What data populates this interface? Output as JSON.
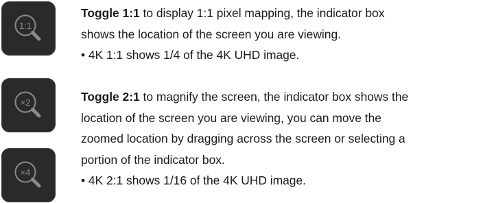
{
  "icons": {
    "zoom_1_1": {
      "label": "1:1",
      "name": "magnifier-1-1-icon"
    },
    "zoom_x2": {
      "label": "×2",
      "name": "magnifier-x2-icon"
    },
    "zoom_x4": {
      "label": "×4",
      "name": "magnifier-x4-icon"
    }
  },
  "section_1": {
    "bold": "Toggle 1:1",
    "lines": [
      " to display 1:1 pixel mapping, the indicator box",
      "shows the location of the screen you are viewing.",
      "• 4K 1:1 shows 1/4 of the 4K UHD image."
    ]
  },
  "section_2": {
    "bold": "Toggle 2:1",
    "lines": [
      " to magnify the screen, the indicator box shows the",
      "location of the screen you are viewing, you can move the",
      "zoomed location by dragging across the screen or selecting a",
      "portion of the indicator box.",
      "• 4K 2:1 shows 1/16 of the 4K UHD image."
    ]
  },
  "colors": {
    "icon_bg": "#2a2a2a",
    "icon_stroke": "#8a8a8a",
    "text": "#1a1a1a"
  }
}
